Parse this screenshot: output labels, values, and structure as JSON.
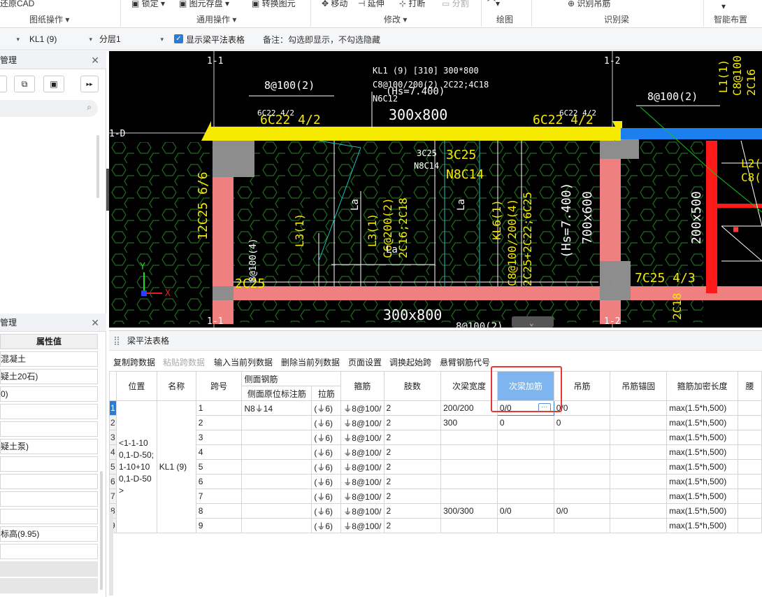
{
  "ribbon": {
    "top_items": [
      "还原CAD",
      "锁定",
      "图元存盘",
      "转换图元",
      "移动",
      "延伸",
      "打断",
      "分割",
      "识别吊筋"
    ],
    "groups": [
      "图纸操作",
      "通用操作",
      "修改",
      "绘图",
      "识别梁",
      "智能布置"
    ]
  },
  "toolbar": {
    "sel1": "KL1 (9)",
    "sel2": "分层1",
    "show_table_label": "显示梁平法表格",
    "note": "备注：勾选即显示，不勾选隐藏"
  },
  "left_panel": {
    "top_title": "管理",
    "bottom_title": "管理",
    "col_header": "属性值",
    "rows": [
      "混凝土",
      "疑土20石)",
      "0)",
      "",
      "",
      "疑土泵)",
      "",
      "",
      "",
      "",
      "标高(9.95)",
      ""
    ]
  },
  "cad": {
    "labels": {
      "a1": "1-1",
      "a2": "1-2",
      "ad": "1-D",
      "beam_name": "KL1 (9)  [310] 300*800",
      "beam_stir": "C8@100/200(2) 2C22;4C18",
      "beam_n": "N6C12",
      "hs": "(Hs=7.400)",
      "stir1": "8@100(2)",
      "stir2": "8@100(2)",
      "top_left": "6C22 4/2",
      "top_right": "6C22 4/2",
      "top_left_small": "6C22 4/2",
      "top_right_small": "6C22 4/2",
      "sec": "300x800",
      "c3c25": "3C25",
      "n8c14": "N8C14",
      "c3c25b": "3C25",
      "n8c14b": "N8C14",
      "left_v": "12C25 6/6",
      "l3a": "L3(1)",
      "l3b": "L3(1)",
      "l3c": "C6@200(2)",
      "l3d": "2C16;2C18",
      "kl": "KL6(1)",
      "kl2": "C8@100/200(4)",
      "kl3": "2C25+2C22;6C25",
      "hs2": "(Hs=7.400)",
      "sec2": "700x600",
      "sec3": "200x500",
      "c7": "7C25 4/3",
      "bot1": "300x800",
      "bot2": "8@100(2)",
      "l1": "L1(1)",
      "l2": "L2(",
      "c8": "C8@100",
      "c16": "2C16",
      "c8b": "C8(",
      "c2c25": "2C25",
      "stir4": "8@100(4)",
      "c2c18": "2C18",
      "la": "La",
      "la2": "La",
      "la3": "La",
      "yaxis": "Y",
      "xaxis": "X"
    }
  },
  "beam_table": {
    "title": "梁平法表格",
    "buttons": [
      "复制跨数据",
      "粘贴跨数据",
      "输入当前列数据",
      "删除当前列数据",
      "页面设置",
      "调换起始跨",
      "悬臂钢筋代号"
    ],
    "headers": {
      "position": "位置",
      "name": "名称",
      "span": "跨号",
      "side_bar": "侧面钢筋",
      "side_bar_sub": "侧面原位标注筋",
      "tie_bar": "拉筋",
      "stirrup": "箍筋",
      "legs": "肢数",
      "sec_width": "次梁宽度",
      "sec_add": "次梁加筋",
      "hanger": "吊筋",
      "hanger_anchor": "吊筋锚固",
      "dense_len": "箍筋加密长度",
      "more": "腰"
    },
    "position_value": "<1-1-100,1-D-50;1-10+100,1-D-50>",
    "name_value": "KL1 (9)",
    "rows": [
      {
        "idx": "1",
        "span": "1",
        "side": "N8⏚14",
        "tie": "(⏚6)",
        "stir": "⏚8@100/",
        "legs": "2",
        "sw": "200/200",
        "sa": "0/0",
        "hg": "0/0",
        "dl": "max(1.5*h,500)"
      },
      {
        "idx": "2",
        "span": "2",
        "side": "",
        "tie": "(⏚6)",
        "stir": "⏚8@100/",
        "legs": "2",
        "sw": "300",
        "sa": "0",
        "hg": "0",
        "dl": "max(1.5*h,500)"
      },
      {
        "idx": "3",
        "span": "3",
        "side": "",
        "tie": "(⏚6)",
        "stir": "⏚8@100/",
        "legs": "2",
        "sw": "",
        "sa": "",
        "hg": "",
        "dl": "max(1.5*h,500)"
      },
      {
        "idx": "4",
        "span": "4",
        "side": "",
        "tie": "(⏚6)",
        "stir": "⏚8@100/",
        "legs": "2",
        "sw": "",
        "sa": "",
        "hg": "",
        "dl": "max(1.5*h,500)"
      },
      {
        "idx": "5",
        "span": "5",
        "side": "",
        "tie": "(⏚6)",
        "stir": "⏚8@100/",
        "legs": "2",
        "sw": "",
        "sa": "",
        "hg": "",
        "dl": "max(1.5*h,500)"
      },
      {
        "idx": "6",
        "span": "6",
        "side": "",
        "tie": "(⏚6)",
        "stir": "⏚8@100/",
        "legs": "2",
        "sw": "",
        "sa": "",
        "hg": "",
        "dl": "max(1.5*h,500)"
      },
      {
        "idx": "7",
        "span": "7",
        "side": "",
        "tie": "(⏚6)",
        "stir": "⏚8@100/",
        "legs": "2",
        "sw": "",
        "sa": "",
        "hg": "",
        "dl": "max(1.5*h,500)"
      },
      {
        "idx": "8",
        "span": "8",
        "side": "",
        "tie": "(⏚6)",
        "stir": "⏚8@100/",
        "legs": "2",
        "sw": "300/300",
        "sa": "0/0",
        "hg": "0/0",
        "dl": "max(1.5*h,500)"
      },
      {
        "idx": "9",
        "span": "9",
        "side": "",
        "tie": "(⏚6)",
        "stir": "⏚8@100/",
        "legs": "2",
        "sw": "",
        "sa": "",
        "hg": "",
        "dl": "max(1.5*h,500)"
      }
    ]
  },
  "colors": {
    "beam_yellow": "#f5ea00",
    "column_pink": "#f07f80",
    "cad_bg": "#000000",
    "highlight": "#7fb5ee",
    "red_box": "#e53935"
  }
}
